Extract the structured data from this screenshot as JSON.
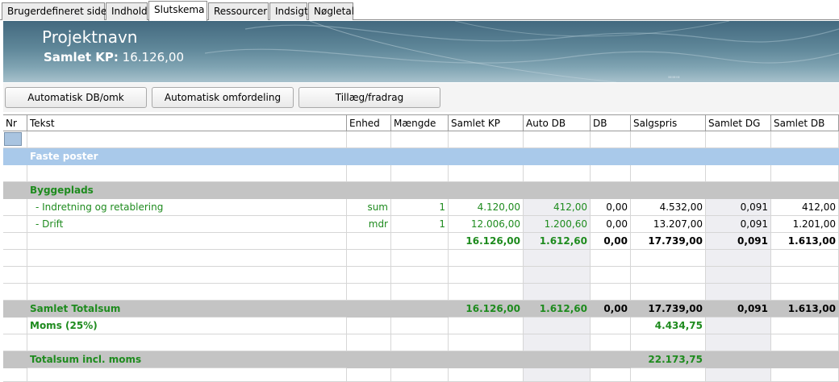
{
  "tabs": [
    "Brugerdefineret side",
    "Indhold",
    "Slutskema",
    "Ressourcer",
    "Indsigt",
    "Nøgletal"
  ],
  "active_tab": "Slutskema",
  "banner": {
    "project_name": "Projektnavn",
    "kp_label": "Samlet KP:",
    "kp_value": "16.126,00"
  },
  "buttons": {
    "auto_db": "Automatisk DB/omk",
    "auto_redistribute": "Automatisk omfordeling",
    "surcharge": "Tillæg/fradrag"
  },
  "columns": [
    "Nr",
    "Tekst",
    "Enhed",
    "Mængde",
    "Samlet KP",
    "Auto DB",
    "DB",
    "Salgspris",
    "Samlet DG",
    "Samlet DB"
  ],
  "rows": {
    "faste_poster": "Faste poster",
    "byggeplads": "Byggeplads",
    "items": [
      {
        "tekst": "- Indretning og retablering",
        "enhed": "sum",
        "maengde": "1",
        "samlet_kp": "4.120,00",
        "auto_db": "412,00",
        "db": "0,00",
        "salgspris": "4.532,00",
        "samlet_dg": "0,091",
        "samlet_db": "412,00"
      },
      {
        "tekst": "- Drift",
        "enhed": "mdr",
        "maengde": "1",
        "samlet_kp": "12.006,00",
        "auto_db": "1.200,60",
        "db": "0,00",
        "salgspris": "13.207,00",
        "samlet_dg": "0,091",
        "samlet_db": "1.201,00"
      }
    ],
    "subtotal": {
      "samlet_kp": "16.126,00",
      "auto_db": "1.612,60",
      "db": "0,00",
      "salgspris": "17.739,00",
      "samlet_dg": "0,091",
      "samlet_db": "1.613,00"
    },
    "total": {
      "label": "Samlet Totalsum",
      "samlet_kp": "16.126,00",
      "auto_db": "1.612,60",
      "db": "0,00",
      "salgspris": "17.739,00",
      "samlet_dg": "0,091",
      "samlet_db": "1.613,00"
    },
    "moms": {
      "label": "Moms (25%)",
      "salgspris": "4.434,75"
    },
    "total_incl": {
      "label": "Totalsum incl. moms",
      "salgspris": "22.173,75"
    }
  },
  "colors": {
    "accent_green": "#1e8b1e",
    "band_blue": "#a9c9ea",
    "band_grey": "#c4c4c4"
  }
}
